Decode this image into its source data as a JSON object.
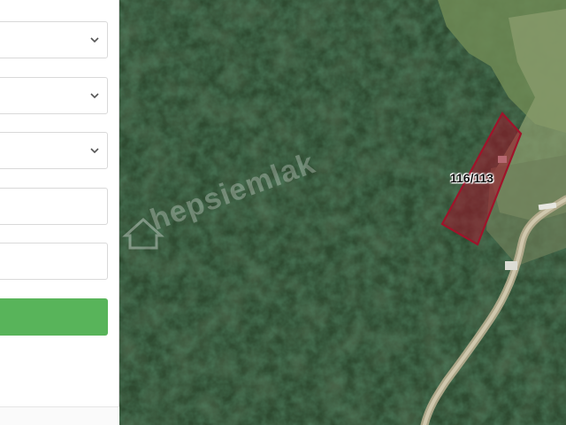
{
  "form": {
    "fields": [
      {
        "type": "select",
        "value": ""
      },
      {
        "type": "select",
        "value": ""
      },
      {
        "type": "select",
        "value": ""
      },
      {
        "type": "text",
        "value": ""
      },
      {
        "type": "text",
        "value": ""
      }
    ],
    "submit_label": ""
  },
  "map": {
    "parcel_label": "116/113",
    "watermark": "hepsiemlak",
    "parcel_color": "#a0132a"
  }
}
